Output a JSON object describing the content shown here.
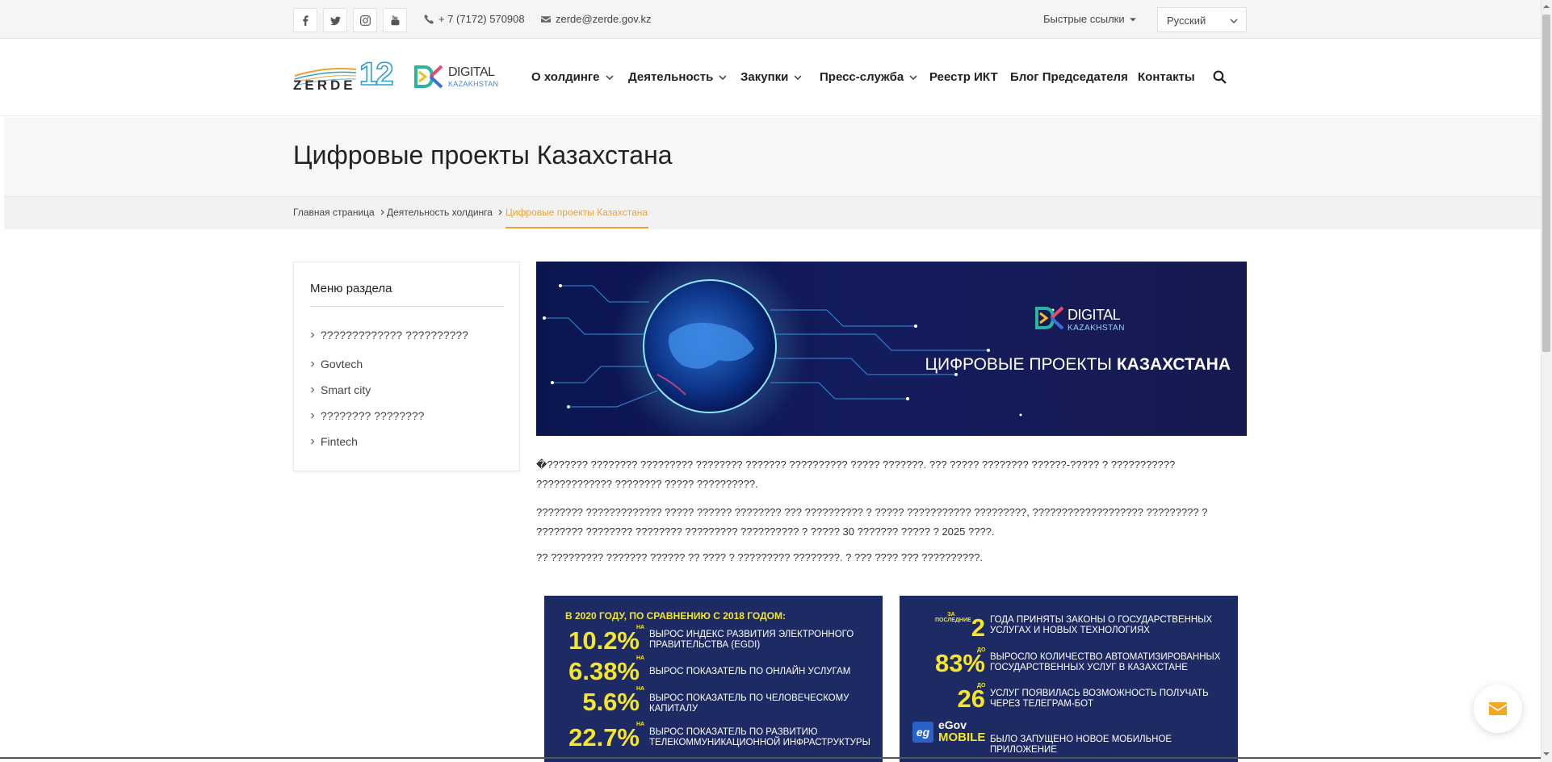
{
  "topbar": {
    "phone": "+ 7 (7172) 570908",
    "email": "zerde@zerde.gov.kz",
    "quick_links": "Быстрые ссылки",
    "language": "Русский"
  },
  "logos": {
    "zerde_text": "ZERDE",
    "zerde_num": "12",
    "dk_line1": "DIGITAL",
    "dk_line2": "KAZAKHSTAN"
  },
  "nav": {
    "items": [
      {
        "label": "О холдинге"
      },
      {
        "label": "Деятельность"
      },
      {
        "label": "Закупки"
      },
      {
        "label": "Пресс-служба"
      },
      {
        "label": "Реестр ИКТ"
      },
      {
        "label": "Блог Председателя"
      },
      {
        "label": "Контакты"
      }
    ]
  },
  "page": {
    "title": "Цифровые проекты Казахстана"
  },
  "breadcrumb": {
    "items": [
      "Главная страница",
      "Деятельность холдинга",
      "Цифровые проекты Казахстана"
    ]
  },
  "sidebar": {
    "title": "Меню раздела",
    "items": [
      "????????????? ??????????",
      "Govtech",
      "Smart city",
      "???????? ????????",
      "Fintech"
    ]
  },
  "banner": {
    "logo_line1": "DIGITAL",
    "logo_line2": "KAZAKHSTAN",
    "title_normal": "ЦИФРОВЫЕ ПРОЕКТЫ ",
    "title_bold": "КАЗАХСТАНА"
  },
  "content": {
    "p1": "�??????? ???????? ????????? ???????? ??????? ?????????? ????? ???????. ??? ????? ???????? ??????-????? ? ??????????? ????????????? ???????? ????? ??????????.",
    "p2": "???????? ????????????? ????? ?????? ???????? ??? ?????????? ? ????? ??????????? ?????????, ??????????????????? ????????? ? ???????? ???????? ???????? ????????? ?????????? ? ????? 30 ??????? ????? ? 2025 ????.",
    "p3": "?? ????????? ??????? ?????? ?? ???? ? ????????? ????????. ? ??? ???? ??? ??????????."
  },
  "infographic_left": {
    "heading": "В 2020 ГОДУ, ПО СРАВНЕНИЮ С 2018 ГОДОМ:",
    "prefix": "НА",
    "stats": [
      {
        "value": "10.2%",
        "text": "ВЫРОС ИНДЕКС РАЗВИТИЯ ЭЛЕКТРОННОГО ПРАВИТЕЛЬСТВА (EGDI)"
      },
      {
        "value": "6.38%",
        "text": "ВЫРОС ПОКАЗАТЕЛЬ ПО ОНЛАЙН УСЛУГАМ"
      },
      {
        "value": "5.6%",
        "text": "ВЫРОС ПОКАЗАТЕЛЬ ПО ЧЕЛОВЕЧЕСКОМУ КАПИТАЛУ"
      },
      {
        "value": "22.7%",
        "text": "ВЫРОС ПОКАЗАТЕЛЬ ПО РАЗВИТИЮ ТЕЛЕКОММУНИКАЦИОННОЙ ИНФРАСТРУКТУРЫ"
      }
    ]
  },
  "infographic_right": {
    "stats": [
      {
        "prefix": "ЗА ПОСЛЕДНИЕ",
        "value": "2",
        "text": "ГОДА ПРИНЯТЫ ЗАКОНЫ О ГОСУДАРСТВЕННЫХ УСЛУГАХ И НОВЫХ ТЕХНОЛОГИЯХ"
      },
      {
        "prefix": "ДО",
        "value": "83%",
        "text": "ВЫРОСЛО КОЛИЧЕСТВО АВТОМАТИЗИРОВАННЫХ ГОСУДАРСТВЕННЫХ УСЛУГ В КАЗАХСТАНЕ"
      },
      {
        "prefix": "ДО",
        "value": "26",
        "text": "УСЛУГ ПОЯВИЛАСЬ ВОЗМОЖНОСТЬ ПОЛУЧАТЬ ЧЕРЕЗ ТЕЛЕГРАМ-БОТ"
      }
    ],
    "egov_icon": "eg",
    "egov_word": "eGov",
    "egov_mobile": "MOBILE",
    "egov_text": "БЫЛО ЗАПУЩЕНО НОВОЕ МОБИЛЬНОЕ ПРИЛОЖЕНИЕ"
  },
  "colors": {
    "accent": "#e8a33d",
    "info_bg": "#1e2a63",
    "info_yellow": "#f5e628",
    "fab_icon": "#f5a623"
  },
  "icons": {
    "social": [
      "facebook-icon",
      "twitter-icon",
      "instagram-icon",
      "youtube-icon"
    ],
    "phone": "phone-icon",
    "email": "envelope-icon",
    "search": "search-icon",
    "fab": "envelope-icon"
  }
}
